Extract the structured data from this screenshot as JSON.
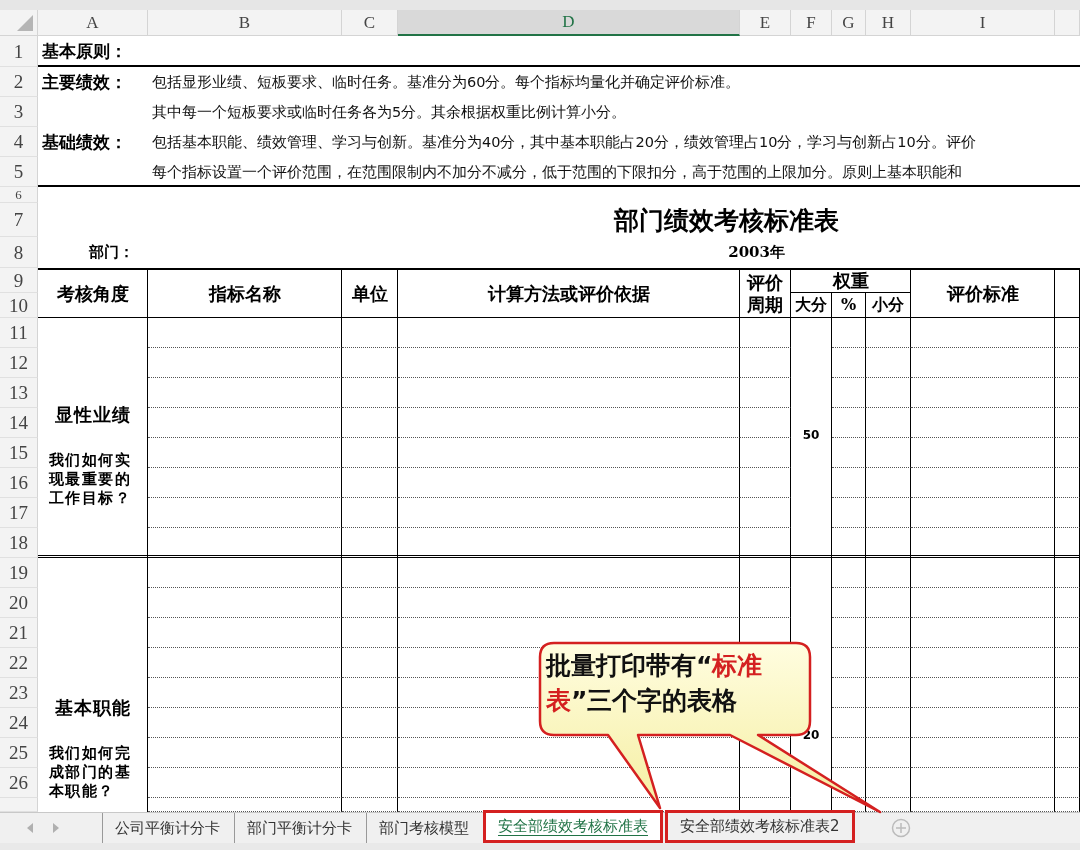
{
  "columns": [
    {
      "label": "A",
      "selected": false
    },
    {
      "label": "B",
      "selected": false
    },
    {
      "label": "C",
      "selected": false
    },
    {
      "label": "D",
      "selected": true
    },
    {
      "label": "E",
      "selected": false
    },
    {
      "label": "F",
      "selected": false
    },
    {
      "label": "G",
      "selected": false
    },
    {
      "label": "H",
      "selected": false
    },
    {
      "label": "I",
      "selected": false
    }
  ],
  "row_numbers": [
    "1",
    "2",
    "3",
    "4",
    "5",
    "6",
    "7",
    "8",
    "9",
    "10",
    "11",
    "12",
    "13",
    "14",
    "15",
    "16",
    "17",
    "18",
    "19",
    "20",
    "21",
    "22",
    "23",
    "24",
    "25",
    "26"
  ],
  "principles": {
    "title": "基本原则：",
    "sections": [
      {
        "label": "主要绩效：",
        "lines": [
          "包括显形业绩、短板要求、临时任务。基准分为60分。每个指标均量化并确定评价标准。",
          "其中每一个短板要求或临时任务各为5分。其余根据权重比例计算小分。"
        ]
      },
      {
        "label": "基础绩效：",
        "lines": [
          "包括基本职能、绩效管理、学习与创新。基准分为40分，其中基本职能占20分，绩效管理占10分，学习与创新占10分。评价",
          "每个指标设置一个评价范围，在范围限制内不加分不减分，低于范围的下限扣分，高于范围的上限加分。原则上基本职能和"
        ]
      }
    ]
  },
  "form": {
    "title": "部门绩效考核标准表",
    "dept_label": "部门：",
    "year": "2003年"
  },
  "table_header": {
    "perspective": "考核角度",
    "indicator": "指标名称",
    "unit": "单位",
    "method": "计算方法或评价依据",
    "period": "评价周期",
    "weight": "权重",
    "major": "大分",
    "percent": "%",
    "minor": "小分",
    "standard": "评价标准"
  },
  "sections": [
    {
      "title": "显性业绩",
      "question": "我们如何实现最重要的工作目标？",
      "weight": "50"
    },
    {
      "title": "基本职能",
      "question": "我们如何完成部门的基本职能？",
      "weight": "20"
    }
  ],
  "callout": {
    "segments": [
      {
        "text": "批量打印带有“",
        "emphasis": false
      },
      {
        "text": "标准表",
        "emphasis": true
      },
      {
        "text": "”三个字的表格",
        "emphasis": false
      }
    ]
  },
  "tabs": [
    {
      "label": "公司平衡计分卡",
      "selected": false,
      "boxed": false
    },
    {
      "label": "部门平衡计分卡",
      "selected": false,
      "boxed": false
    },
    {
      "label": "部门考核模型",
      "selected": false,
      "boxed": false
    },
    {
      "label": "安全部绩效考核标准表",
      "selected": true,
      "boxed": true
    },
    {
      "label": "安全部绩效考核标准表2",
      "selected": false,
      "boxed": true
    }
  ]
}
